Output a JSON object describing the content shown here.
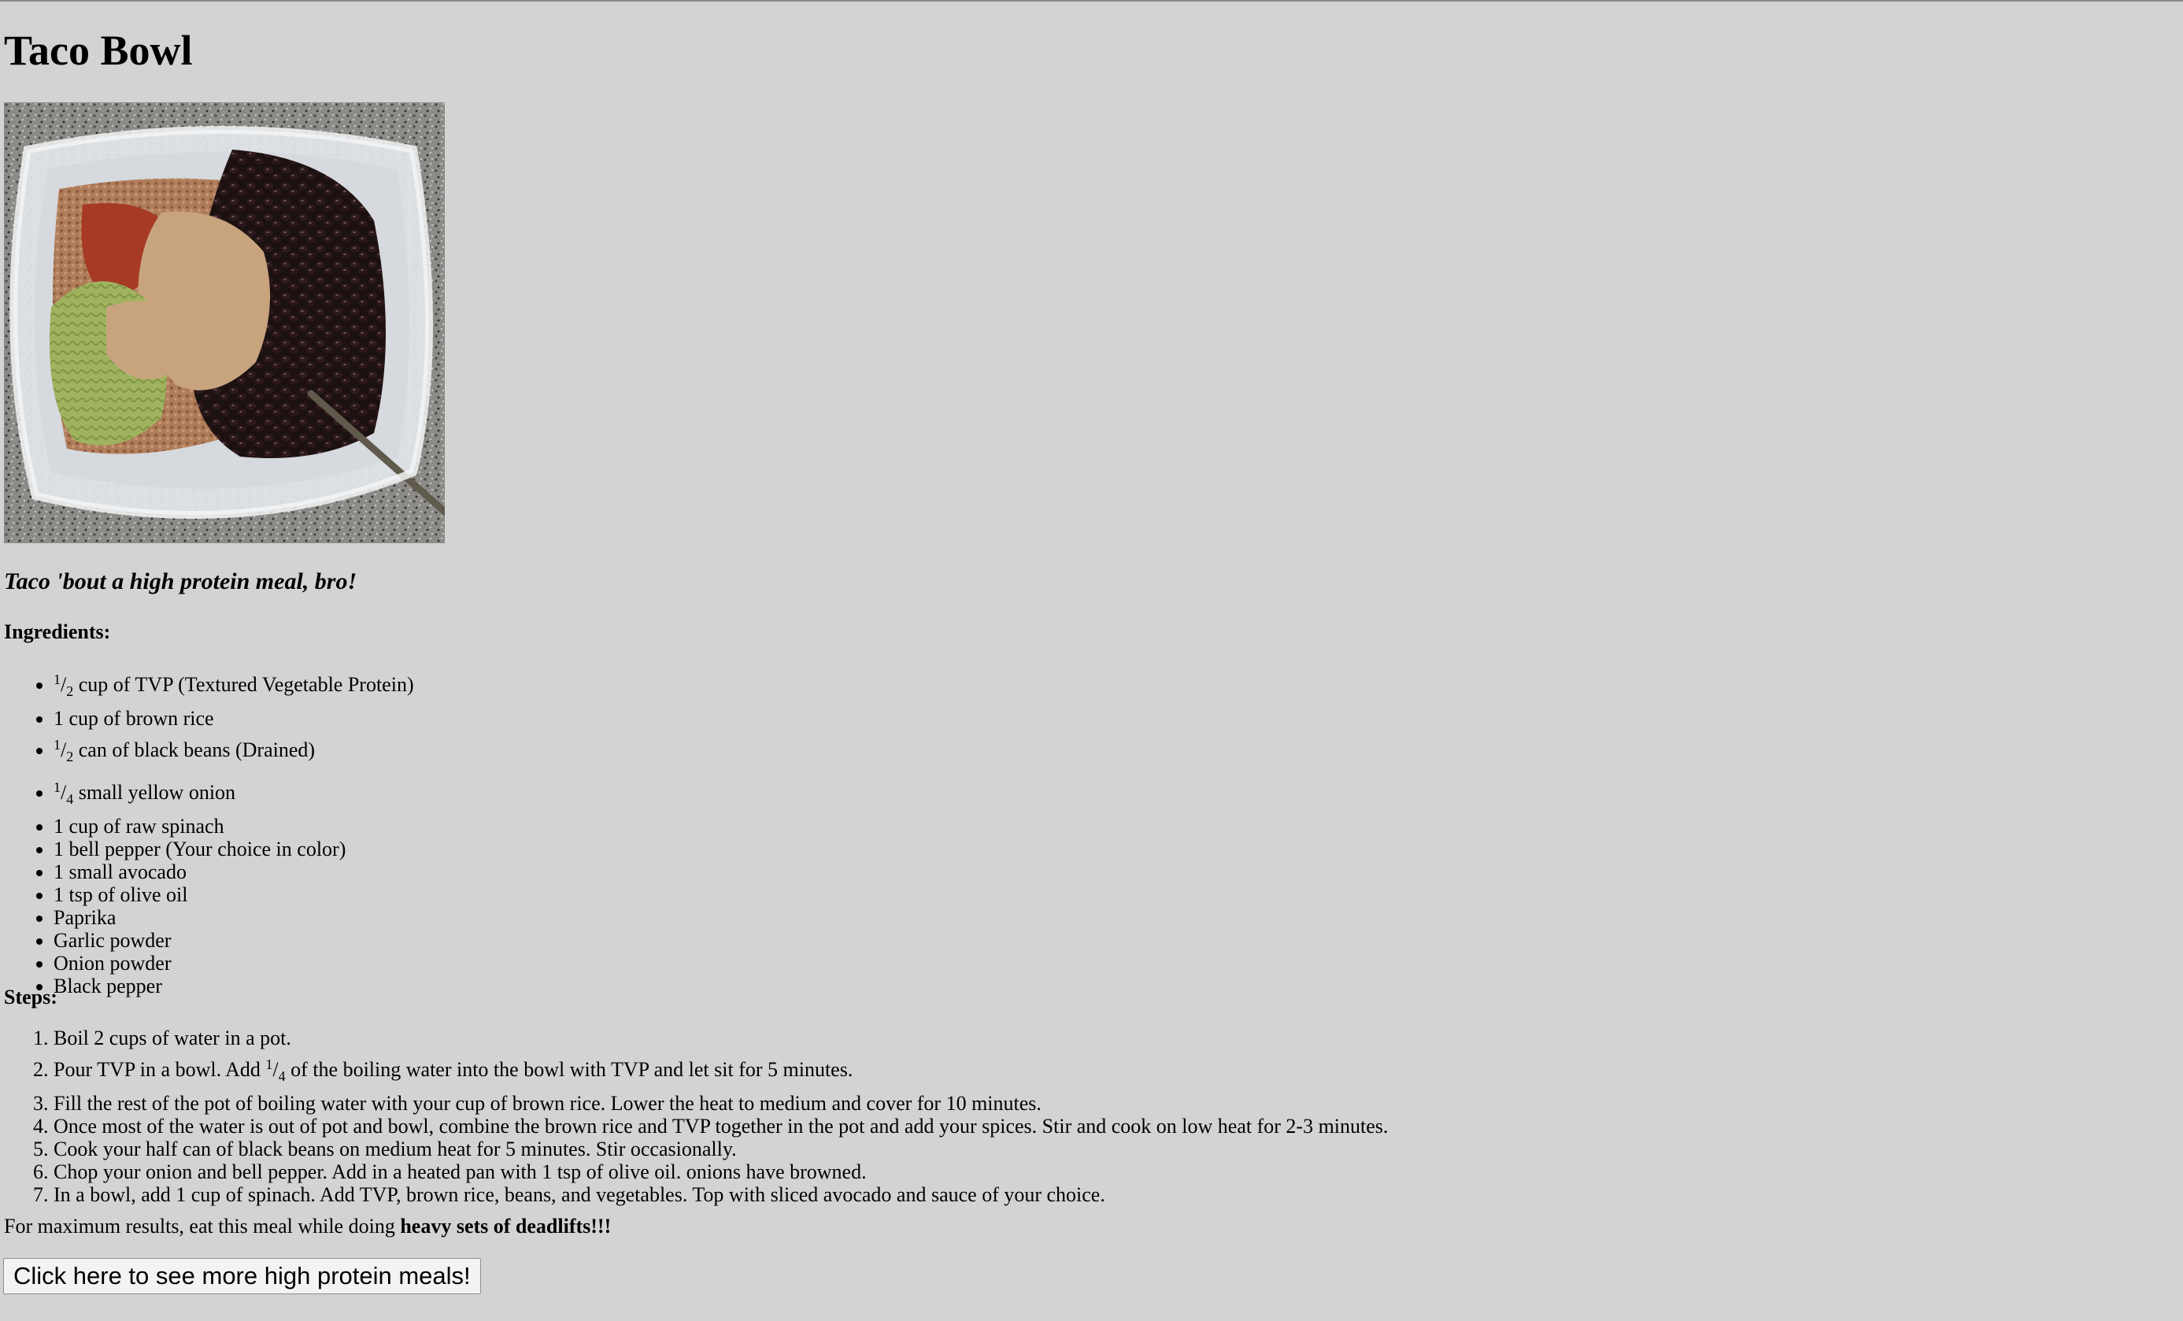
{
  "title": "Taco Bowl",
  "tagline": "Taco 'bout a high protein meal, bro!",
  "ingredients_heading": "Ingredients:",
  "ingredients": [
    {
      "num": "1",
      "den": "2",
      "text": " cup of TVP (Textured Vegetable Protein)"
    },
    {
      "text": "1 cup of brown rice"
    },
    {
      "num": "1",
      "den": "2",
      "text": " can of black beans (Drained)"
    },
    {
      "num": "1",
      "den": "4",
      "text": " small yellow onion"
    },
    {
      "text": "1 cup of raw spinach"
    },
    {
      "text": "1 bell pepper (Your choice in color)"
    },
    {
      "text": "1 small avocado"
    },
    {
      "text": "1 tsp of olive oil"
    },
    {
      "text": "Paprika"
    },
    {
      "text": "Garlic powder"
    },
    {
      "text": "Onion powder"
    },
    {
      "text": "Black pepper"
    }
  ],
  "steps_heading": "Steps:",
  "steps": [
    {
      "text": "Boil 2 cups of water in a pot."
    },
    {
      "before": "Pour TVP in a bowl. Add ",
      "num": "1",
      "den": "4",
      "after": " of the boiling water into the bowl with TVP and let sit for 5 minutes."
    },
    {
      "text": "Fill the rest of the pot of boiling water with your cup of brown rice. Lower the heat to medium and cover for 10 minutes."
    },
    {
      "text": "Once most of the water is out of pot and bowl, combine the brown rice and TVP together in the pot and add your spices. Stir and cook on low heat for 2-3 minutes."
    },
    {
      "text": "Cook your half can of black beans on medium heat for 5 minutes. Stir occasionally."
    },
    {
      "text": "Chop your onion and bell pepper. Add in a heated pan with 1 tsp of olive oil. onions have browned."
    },
    {
      "text": "In a bowl, add 1 cup of spinach. Add TVP, brown rice, beans, and vegetables. Top with sliced avocado and sauce of your choice."
    }
  ],
  "final_note": {
    "prefix": "For maximum results, eat this meal while doing ",
    "emphasis": "heavy sets of deadlifts!!!"
  },
  "more_button_label": "Click here to see more high protein meals!",
  "colors": {
    "background": "#d3d3d3",
    "button_bg": "#f3f3f3"
  }
}
